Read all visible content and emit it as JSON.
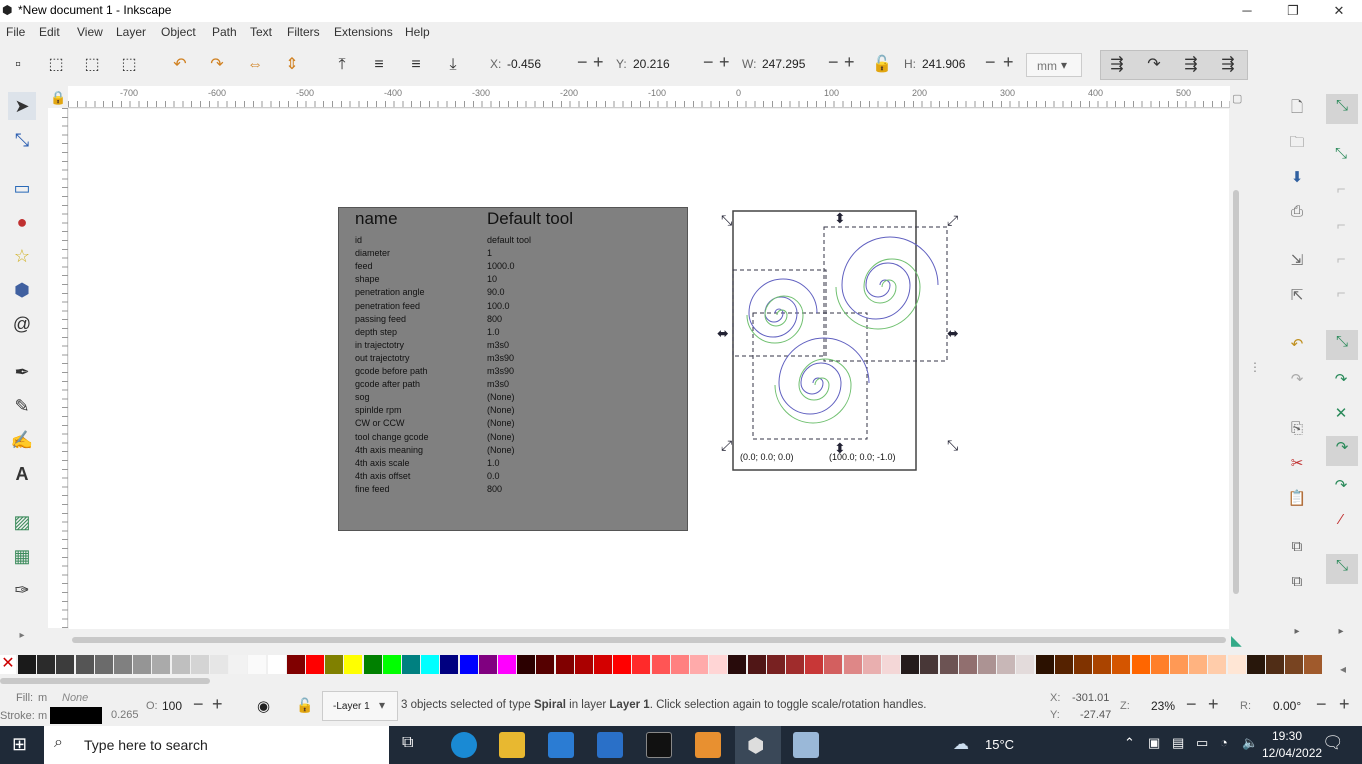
{
  "window": {
    "title": "*New document 1 - Inkscape",
    "minimize": "─",
    "maximize": "❐",
    "close": "✕"
  },
  "menu": [
    "File",
    "Edit",
    "View",
    "Layer",
    "Object",
    "Path",
    "Text",
    "Filters",
    "Extensions",
    "Help"
  ],
  "toolbar": {
    "x_label": "X:",
    "x_value": "-0.456",
    "y_label": "Y:",
    "y_value": "20.216",
    "w_label": "W:",
    "w_value": "247.295",
    "h_label": "H:",
    "h_value": "241.906",
    "unit": "mm"
  },
  "ruler": {
    "top_ticks": [
      "-700",
      "-600",
      "-500",
      "-400",
      "-300",
      "-200",
      "-100",
      "0",
      "100",
      "200",
      "300",
      "400",
      "500"
    ]
  },
  "canvas": {
    "table": {
      "header_name": "name",
      "header_value": "Default tool",
      "rows": [
        [
          "id",
          "default tool"
        ],
        [
          "diameter",
          "1"
        ],
        [
          "feed",
          "1000.0"
        ],
        [
          "shape",
          "10"
        ],
        [
          "penetration angle",
          "90.0"
        ],
        [
          "penetration feed",
          "100.0"
        ],
        [
          "passing feed",
          "800"
        ],
        [
          "depth step",
          "1.0"
        ],
        [
          "in trajectotry",
          "m3s0"
        ],
        [
          "out trajectotry",
          "m3s90"
        ],
        [
          "gcode before path",
          "m3s90"
        ],
        [
          "gcode after path",
          "m3s0"
        ],
        [
          "sog",
          "(None)"
        ],
        [
          "spinlde rpm",
          "(None)"
        ],
        [
          "CW or CCW",
          "(None)"
        ],
        [
          "tool change gcode",
          "(None)"
        ],
        [
          "4th axis meaning",
          "(None)"
        ],
        [
          "4th axis scale",
          "1.0"
        ],
        [
          "4th axis offset",
          "0.0"
        ],
        [
          "fine feed",
          "800"
        ]
      ]
    },
    "label_origin": "(0.0; 0.0; 0.0)",
    "label_point": "(100.0; 0.0; -1.0)"
  },
  "status": {
    "fill_label": "Fill:",
    "fill_value": "m",
    "fill_none": "None",
    "stroke_label": "Stroke:",
    "stroke_value": "m",
    "stroke_width": "0.265",
    "opacity_label": "O:",
    "opacity_value": "100",
    "layer": "-Layer 1",
    "message_pre": "3 objects selected of type ",
    "message_type": "Spiral",
    "message_mid": " in layer ",
    "message_layer": "Layer 1",
    "message_post": ". Click selection again to toggle scale/rotation handles.",
    "cursor_x_label": "X:",
    "cursor_x": "-301.01",
    "cursor_y_label": "Y:",
    "cursor_y": "-27.47",
    "zoom_label": "Z:",
    "zoom": "23%",
    "rotate_label": "R:",
    "rotate": "0.00°"
  },
  "taskbar": {
    "search_placeholder": "Type here to search",
    "weather": "15°C",
    "time": "19:30",
    "date": "12/04/2022"
  },
  "colors": {
    "accent_selection": "#dbe8f5",
    "table_bg": "#808080",
    "spiral_blue": "#5050b0",
    "spiral_green": "#60b060"
  }
}
